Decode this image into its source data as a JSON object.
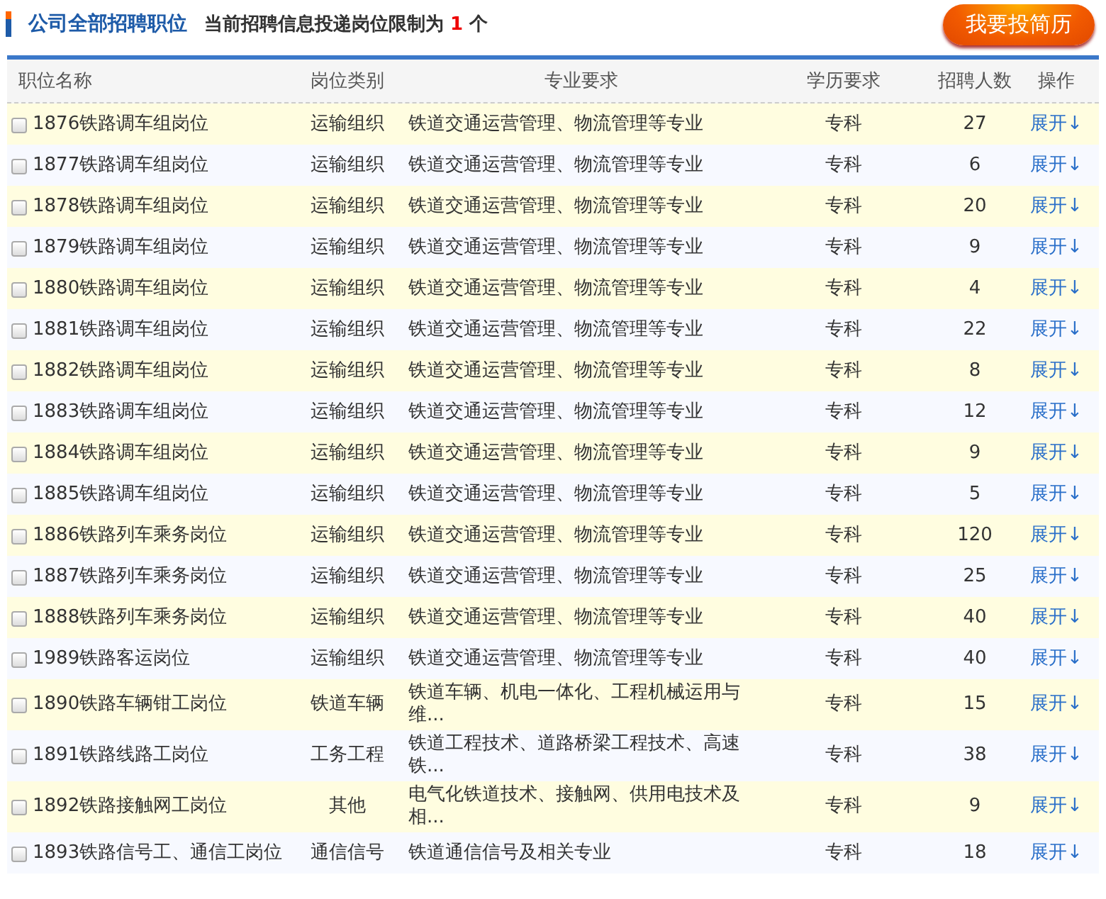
{
  "header": {
    "title": "公司全部招聘职位",
    "notice": "当前招聘信息投递岗位限制为 **1** 个",
    "apply_button": "我要投简历"
  },
  "table": {
    "columns": [
      "职位名称",
      "岗位类别",
      "专业要求",
      "学历要求",
      "招聘人数",
      "操作"
    ],
    "rows": [
      {
        "checked": false,
        "name": "1876铁路调车组岗位",
        "category": "运输组织",
        "major": "铁道交通运营管理、物流管理等专业",
        "education": "专科",
        "count": "27",
        "action": "展开↓"
      },
      {
        "checked": false,
        "name": "1877铁路调车组岗位",
        "category": "运输组织",
        "major": "铁道交通运营管理、物流管理等专业",
        "education": "专科",
        "count": "6",
        "action": "展开↓"
      },
      {
        "checked": false,
        "name": "1878铁路调车组岗位",
        "category": "运输组织",
        "major": "铁道交通运营管理、物流管理等专业",
        "education": "专科",
        "count": "20",
        "action": "展开↓"
      },
      {
        "checked": false,
        "name": "1879铁路调车组岗位",
        "category": "运输组织",
        "major": "铁道交通运营管理、物流管理等专业",
        "education": "专科",
        "count": "9",
        "action": "展开↓"
      },
      {
        "checked": false,
        "name": "1880铁路调车组岗位",
        "category": "运输组织",
        "major": "铁道交通运营管理、物流管理等专业",
        "education": "专科",
        "count": "4",
        "action": "展开↓"
      },
      {
        "checked": false,
        "name": "1881铁路调车组岗位",
        "category": "运输组织",
        "major": "铁道交通运营管理、物流管理等专业",
        "education": "专科",
        "count": "22",
        "action": "展开↓"
      },
      {
        "checked": false,
        "name": "1882铁路调车组岗位",
        "category": "运输组织",
        "major": "铁道交通运营管理、物流管理等专业",
        "education": "专科",
        "count": "8",
        "action": "展开↓"
      },
      {
        "checked": false,
        "name": "1883铁路调车组岗位",
        "category": "运输组织",
        "major": "铁道交通运营管理、物流管理等专业",
        "education": "专科",
        "count": "12",
        "action": "展开↓"
      },
      {
        "checked": false,
        "name": "1884铁路调车组岗位",
        "category": "运输组织",
        "major": "铁道交通运营管理、物流管理等专业",
        "education": "专科",
        "count": "9",
        "action": "展开↓"
      },
      {
        "checked": false,
        "name": "1885铁路调车组岗位",
        "category": "运输组织",
        "major": "铁道交通运营管理、物流管理等专业",
        "education": "专科",
        "count": "5",
        "action": "展开↓"
      },
      {
        "checked": false,
        "name": "1886铁路列车乘务岗位",
        "category": "运输组织",
        "major": "铁道交通运营管理、物流管理等专业",
        "education": "专科",
        "count": "120",
        "action": "展开↓"
      },
      {
        "checked": false,
        "name": "1887铁路列车乘务岗位",
        "category": "运输组织",
        "major": "铁道交通运营管理、物流管理等专业",
        "education": "专科",
        "count": "25",
        "action": "展开↓"
      },
      {
        "checked": false,
        "name": "1888铁路列车乘务岗位",
        "category": "运输组织",
        "major": "铁道交通运营管理、物流管理等专业",
        "education": "专科",
        "count": "40",
        "action": "展开↓"
      },
      {
        "checked": false,
        "name": "1989铁路客运岗位",
        "category": "运输组织",
        "major": "铁道交通运营管理、物流管理等专业",
        "education": "专科",
        "count": "40",
        "action": "展开↓"
      },
      {
        "checked": false,
        "name": "1890铁路车辆钳工岗位",
        "category": "铁道车辆",
        "major": "铁道车辆、机电一体化、工程机械运用与维...",
        "education": "专科",
        "count": "15",
        "action": "展开↓"
      },
      {
        "checked": false,
        "name": "1891铁路线路工岗位",
        "category": "工务工程",
        "major": "铁道工程技术、道路桥梁工程技术、高速铁...",
        "education": "专科",
        "count": "38",
        "action": "展开↓"
      },
      {
        "checked": false,
        "name": "1892铁路接触网工岗位",
        "category": "其他",
        "major": "电气化铁道技术、接触网、供用电技术及相...",
        "education": "专科",
        "count": "9",
        "action": "展开↓"
      },
      {
        "checked": false,
        "name": "1893铁路信号工、通信工岗位",
        "category": "通信信号",
        "major": "铁道通信信号及相关专业",
        "education": "专科",
        "count": "18",
        "action": "展开↓"
      }
    ]
  }
}
